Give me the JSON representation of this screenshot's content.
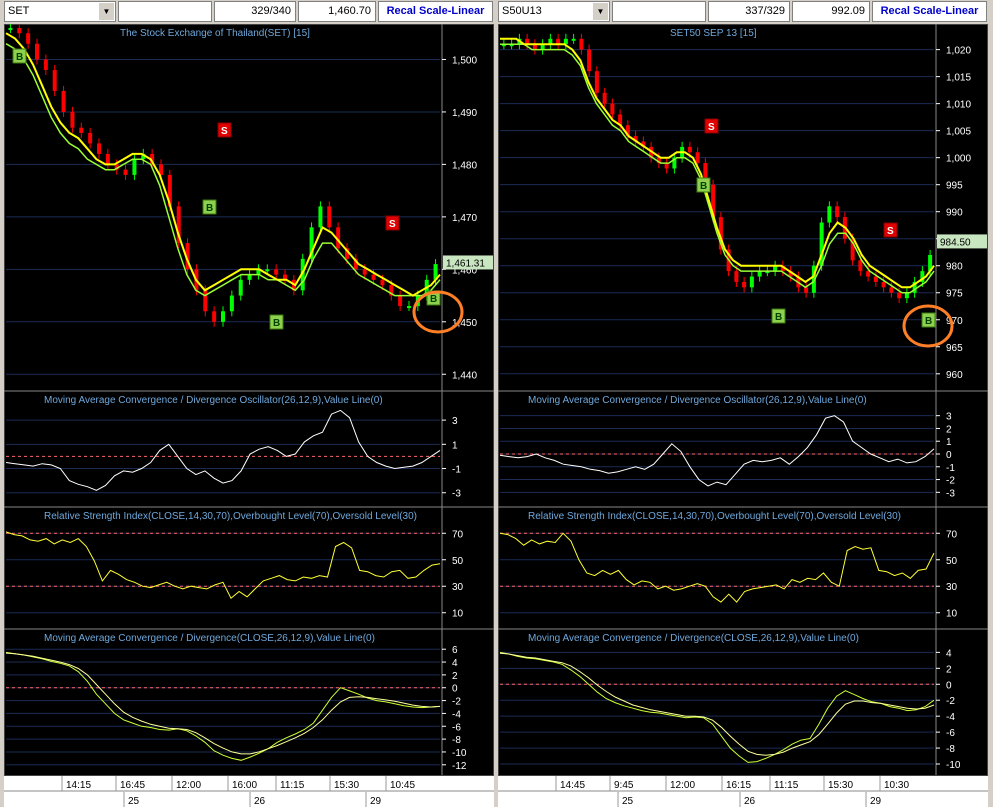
{
  "left": {
    "symbol": "SET",
    "bar_count": "329/340",
    "price": "1,460.70",
    "recal_label": "Recal Scale-Linear",
    "price_panel": {
      "title": "The Stock Exchange of Thailand(SET) [15]",
      "ticks": [
        "1,500",
        "1,490",
        "1,480",
        "1,470",
        "1,460",
        "1,450",
        "1,440"
      ],
      "last_label": "1,461.31",
      "ylim": [
        1437,
        1506
      ]
    },
    "macd_osc": {
      "title": "Moving Average Convergence / Divergence Oscillator(26,12,9),Value Line(0)",
      "ticks": [
        "3",
        "1",
        "-1",
        "-3"
      ]
    },
    "rsi": {
      "title": "Relative Strength Index(CLOSE,14,30,70),Overbought Level(70),Oversold Level(30)",
      "ticks": [
        "70",
        "50",
        "30",
        "10"
      ]
    },
    "macd": {
      "title": "Moving Average Convergence / Divergence(CLOSE,26,12,9),Value Line(0)",
      "ticks": [
        "6",
        "4",
        "2",
        "0",
        "-2",
        "-4",
        "-6",
        "-8",
        "-10",
        "-12"
      ]
    },
    "time_labels": [
      "14:15",
      "16:45",
      "12:00",
      "16:00",
      "11:15",
      "15:30",
      "10:45"
    ],
    "date_labels": [
      "25",
      "26",
      "29"
    ],
    "signals": [
      "B",
      "S",
      "B",
      "B",
      "S",
      "B"
    ]
  },
  "right": {
    "symbol": "S50U13",
    "bar_count": "337/329",
    "price": "992.09",
    "recal_label": "Recal Scale-Linear",
    "price_panel": {
      "title": "SET50 SEP 13  [15]",
      "ticks": [
        "1,020",
        "1,015",
        "1,010",
        "1,005",
        "1,000",
        "995",
        "990",
        "985",
        "980",
        "975",
        "970",
        "965",
        "960"
      ],
      "last_label": "984.50",
      "ylim": [
        957,
        1024
      ]
    },
    "macd_osc": {
      "title": "Moving Average Convergence / Divergence Oscillator(26,12,9),Value Line(0)",
      "ticks": [
        "3",
        "2",
        "1",
        "0",
        "-1",
        "-2",
        "-3"
      ]
    },
    "rsi": {
      "title": "Relative Strength Index(CLOSE,14,30,70),Overbought Level(70),Oversold Level(30)",
      "ticks": [
        "70",
        "50",
        "30",
        "10"
      ]
    },
    "macd": {
      "title": "Moving Average Convergence / Divergence(CLOSE,26,12,9),Value Line(0)",
      "ticks": [
        "4",
        "2",
        "0",
        "-2",
        "-4",
        "-6",
        "-8",
        "-10"
      ]
    },
    "time_labels": [
      "14:45",
      "9:45",
      "12:00",
      "16:15",
      "11:15",
      "15:30",
      "10:30"
    ],
    "date_labels": [
      "25",
      "26",
      "29"
    ],
    "signals": [
      "S",
      "B",
      "B",
      "S",
      "B"
    ]
  },
  "colors": {
    "up": "#00ff00",
    "down": "#ff0000",
    "ema_fast": "#ffff00",
    "ema_slow": "#99ff33",
    "axis": "#ffffff",
    "title": "#6fa8dc",
    "level": "#ff6666",
    "highlight": "#ff7f27"
  },
  "chart_data": [
    {
      "type": "candlestick",
      "title": "The Stock Exchange of Thailand(SET) [15]",
      "ylim": [
        1437,
        1506
      ],
      "close": [
        1506,
        1505,
        1503,
        1500,
        1498,
        1494,
        1490,
        1487,
        1486,
        1484,
        1482,
        1480,
        1479,
        1478,
        1481,
        1482,
        1480,
        1478,
        1472,
        1465,
        1460,
        1456,
        1452,
        1450,
        1452,
        1455,
        1458,
        1459,
        1460,
        1460,
        1459,
        1458,
        1456,
        1462,
        1468,
        1472,
        1468,
        1464,
        1462,
        1460,
        1459,
        1458,
        1457,
        1455,
        1453,
        1453,
        1455,
        1458,
        1461
      ],
      "ema_fast": [
        1505,
        1504,
        1502,
        1499,
        1495,
        1491,
        1488,
        1486,
        1485,
        1483,
        1481,
        1480,
        1480,
        1481,
        1482,
        1482,
        1481,
        1478,
        1473,
        1467,
        1462,
        1458,
        1456,
        1457,
        1458,
        1459,
        1460,
        1460,
        1460,
        1459,
        1458,
        1458,
        1457,
        1460,
        1464,
        1468,
        1467,
        1465,
        1463,
        1461,
        1460,
        1459,
        1458,
        1457,
        1456,
        1455,
        1456,
        1457,
        1459
      ],
      "ema_slow": [
        1503,
        1502,
        1500,
        1497,
        1493,
        1489,
        1486,
        1484,
        1483,
        1481,
        1480,
        1479,
        1479,
        1480,
        1481,
        1481,
        1480,
        1476,
        1470,
        1464,
        1459,
        1456,
        1455,
        1456,
        1457,
        1458,
        1459,
        1459,
        1459,
        1458,
        1458,
        1457,
        1456,
        1458,
        1462,
        1465,
        1465,
        1463,
        1461,
        1459,
        1458,
        1457,
        1456,
        1455,
        1455,
        1455,
        1455,
        1456,
        1458
      ],
      "macd_osc": [
        -0.5,
        -0.6,
        -0.7,
        -0.8,
        -0.6,
        -0.7,
        -1,
        -2,
        -2.3,
        -2.5,
        -2.8,
        -2.4,
        -1.6,
        -1.2,
        -1.3,
        -1,
        -0.5,
        0.5,
        1,
        0,
        -1,
        -1.5,
        -1.2,
        -1.8,
        -2.2,
        -2,
        -1.2,
        0.2,
        0.6,
        0.8,
        0.5,
        0,
        0.2,
        1.2,
        1.7,
        2,
        3.5,
        3.8,
        3.2,
        1.2,
        0,
        -0.5,
        -0.8,
        -1,
        -0.9,
        -0.8,
        -0.5,
        0,
        0.5
      ],
      "rsi": [
        71,
        69,
        68,
        65,
        64,
        66,
        62,
        65,
        63,
        66,
        60,
        49,
        34,
        42,
        39,
        35,
        33,
        30,
        29,
        31,
        33,
        30,
        28,
        30,
        29,
        28,
        31,
        33,
        21,
        26,
        22,
        28,
        34,
        36,
        38,
        35,
        34,
        37,
        36,
        38,
        37,
        60,
        63,
        59,
        42,
        41,
        38,
        37,
        41,
        42,
        36,
        37,
        42,
        46,
        47
      ],
      "macd_line": [
        5.5,
        5.3,
        5.1,
        4.8,
        4.5,
        4.1,
        3.8,
        3.4,
        2.5,
        1,
        -1,
        -2.5,
        -4,
        -5,
        -5.5,
        -6,
        -6.2,
        -6.5,
        -6.6,
        -6.4,
        -6.7,
        -7.5,
        -8.5,
        -9.8,
        -10.5,
        -11,
        -11.3,
        -10.8,
        -10.2,
        -9.5,
        -8.5,
        -7.8,
        -7.2,
        -6.5,
        -5.5,
        -3.5,
        -1.5,
        0,
        -0.5,
        -1,
        -1.6,
        -2,
        -2.2,
        -2.5,
        -2.8,
        -3,
        -3.1,
        -3,
        -2.9
      ],
      "macd_signal": [
        5.4,
        5.3,
        5.1,
        4.9,
        4.6,
        4.3,
        4,
        3.6,
        3,
        2,
        0.5,
        -1,
        -2.5,
        -3.8,
        -4.6,
        -5.2,
        -5.7,
        -6,
        -6.3,
        -6.4,
        -6.5,
        -7,
        -7.8,
        -8.7,
        -9.4,
        -10,
        -10.3,
        -10.3,
        -10,
        -9.5,
        -9,
        -8.4,
        -7.8,
        -7.1,
        -6.2,
        -5,
        -3.5,
        -2.2,
        -1.5,
        -1.4,
        -1.5,
        -1.7,
        -1.9,
        -2.1,
        -2.4,
        -2.7,
        -2.9,
        -3,
        -2.9
      ]
    },
    {
      "type": "candlestick",
      "title": "SET50 SEP 13  [15]",
      "ylim": [
        957,
        1024
      ],
      "close": [
        1021,
        1021,
        1022,
        1021,
        1020,
        1021,
        1022,
        1021,
        1022,
        1022,
        1020,
        1016,
        1012,
        1010,
        1008,
        1006,
        1004,
        1003,
        1002,
        1000,
        999,
        998,
        1000,
        1002,
        1001,
        999,
        995,
        989,
        983,
        979,
        977,
        976,
        978,
        979,
        979,
        980,
        979,
        978,
        976,
        975,
        980,
        988,
        991,
        989,
        985,
        981,
        979,
        978,
        977,
        976,
        975,
        974,
        975,
        977,
        979,
        982
      ],
      "ema_fast": [
        1022,
        1022,
        1022,
        1021,
        1021,
        1021,
        1021,
        1021,
        1021,
        1020,
        1018,
        1014,
        1011,
        1009,
        1007,
        1006,
        1004,
        1003,
        1002,
        1001,
        1000,
        1000,
        1001,
        1001,
        1000,
        997,
        992,
        987,
        983,
        981,
        980,
        980,
        980,
        980,
        980,
        980,
        979,
        978,
        977,
        978,
        982,
        986,
        988,
        987,
        985,
        982,
        980,
        979,
        978,
        977,
        976,
        976,
        977,
        978,
        980
      ],
      "ema_slow": [
        1021,
        1021,
        1021,
        1021,
        1020,
        1020,
        1020,
        1020,
        1020,
        1019,
        1017,
        1013,
        1010,
        1008,
        1006,
        1005,
        1003,
        1002,
        1001,
        1000,
        999,
        999,
        1000,
        1000,
        999,
        996,
        991,
        986,
        982,
        980,
        979,
        979,
        979,
        979,
        979,
        979,
        978,
        977,
        976,
        977,
        980,
        984,
        986,
        986,
        984,
        981,
        979,
        978,
        977,
        976,
        975,
        975,
        976,
        977,
        979
      ],
      "macd_osc": [
        -0.1,
        -0.2,
        -0.3,
        -0.2,
        0,
        -0.3,
        -0.5,
        -0.8,
        -0.9,
        -1,
        -1.2,
        -1.3,
        -1.5,
        -1.4,
        -1.2,
        -1,
        -1.2,
        -0.8,
        0,
        0.8,
        0.2,
        -1,
        -2,
        -2.5,
        -2.2,
        -2.4,
        -1.6,
        -0.8,
        -0.5,
        -0.6,
        -0.5,
        -0.3,
        -0.8,
        -0.2,
        0.5,
        1.5,
        2.8,
        3,
        2.5,
        1,
        0.5,
        0,
        -0.3,
        -0.6,
        -0.4,
        -0.7,
        -0.6,
        -0.2,
        0.4
      ],
      "rsi": [
        70,
        69,
        66,
        61,
        65,
        62,
        64,
        63,
        70,
        64,
        50,
        40,
        38,
        42,
        39,
        42,
        35,
        31,
        34,
        33,
        28,
        30,
        27,
        28,
        30,
        32,
        30,
        22,
        18,
        24,
        18,
        26,
        28,
        29,
        30,
        31,
        28,
        35,
        33,
        36,
        35,
        40,
        33,
        30,
        57,
        60,
        58,
        59,
        42,
        41,
        38,
        40,
        36,
        42,
        43,
        55
      ],
      "macd_line": [
        4,
        3.8,
        3.5,
        3.3,
        3.2,
        3,
        2.8,
        2.5,
        1.8,
        1,
        0,
        -1,
        -1.8,
        -2.3,
        -2.7,
        -3,
        -3.3,
        -3.5,
        -3.6,
        -3.8,
        -4,
        -4.2,
        -4.1,
        -4.2,
        -5,
        -6.5,
        -8,
        -9,
        -9.8,
        -9.7,
        -9.3,
        -8.8,
        -8.2,
        -7.5,
        -7,
        -6.8,
        -5,
        -3,
        -1.5,
        -0.8,
        -1.3,
        -1.8,
        -2.2,
        -2.4,
        -2.8,
        -3,
        -3.3,
        -3.2,
        -2.8,
        -2
      ],
      "macd_signal": [
        3.9,
        3.8,
        3.6,
        3.4,
        3.3,
        3.1,
        2.9,
        2.7,
        2.3,
        1.6,
        0.8,
        -0.1,
        -0.9,
        -1.6,
        -2.1,
        -2.6,
        -2.9,
        -3.2,
        -3.4,
        -3.6,
        -3.8,
        -4,
        -4,
        -4.1,
        -4.5,
        -5.4,
        -6.5,
        -7.5,
        -8.4,
        -8.8,
        -8.9,
        -8.8,
        -8.5,
        -8,
        -7.6,
        -7.2,
        -6.3,
        -5,
        -3.6,
        -2.5,
        -2.1,
        -2.1,
        -2.3,
        -2.4,
        -2.6,
        -2.8,
        -3,
        -3.1,
        -3,
        -2.6
      ]
    }
  ]
}
